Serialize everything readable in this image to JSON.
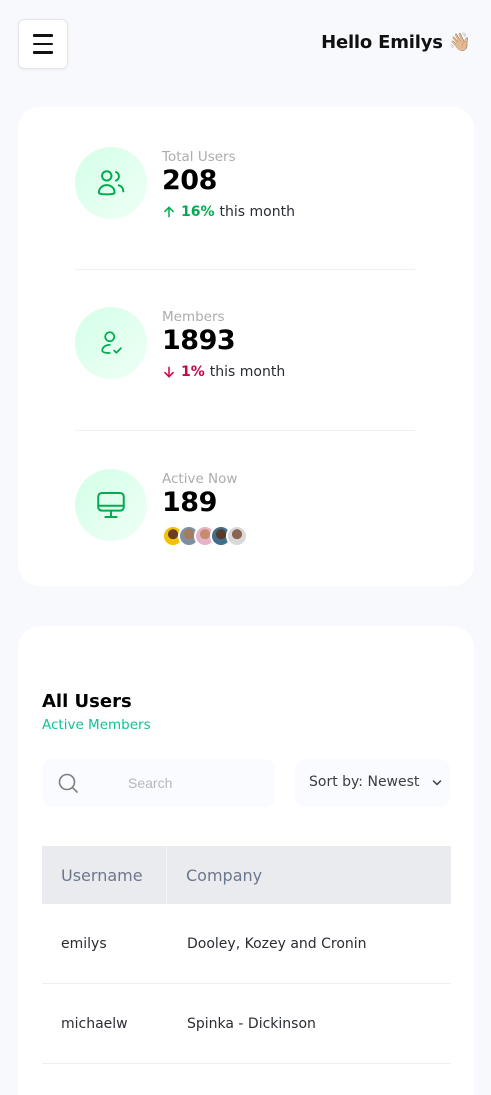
{
  "header": {
    "greeting": "Hello Emilys",
    "wave_emoji": "👋🏼",
    "menu_icon": "hamburger-menu-icon"
  },
  "stats": [
    {
      "label": "Total Users",
      "value": "208",
      "change_pct": "16%",
      "change_text": "this month",
      "direction": "up",
      "icon": "users-icon"
    },
    {
      "label": "Members",
      "value": "1893",
      "change_pct": "1%",
      "change_text": "this month",
      "direction": "down",
      "icon": "user-check-icon"
    },
    {
      "label": "Active Now",
      "value": "189",
      "icon": "monitor-icon",
      "avatar_count": 5
    }
  ],
  "colors": {
    "accent_green": "#00ac4f",
    "accent_teal": "#16c098",
    "down_red": "#d0004b",
    "icon_bg": "#d3ffe7"
  },
  "users": {
    "title": "All Users",
    "subtitle": "Active Members",
    "search_placeholder": "Search",
    "sort_label": "Sort by: Newest",
    "columns": [
      "Username",
      "Company"
    ],
    "rows": [
      {
        "username": "emilys",
        "company": "Dooley, Kozey and Cronin"
      },
      {
        "username": "michaelw",
        "company": "Spinka - Dickinson"
      }
    ]
  }
}
